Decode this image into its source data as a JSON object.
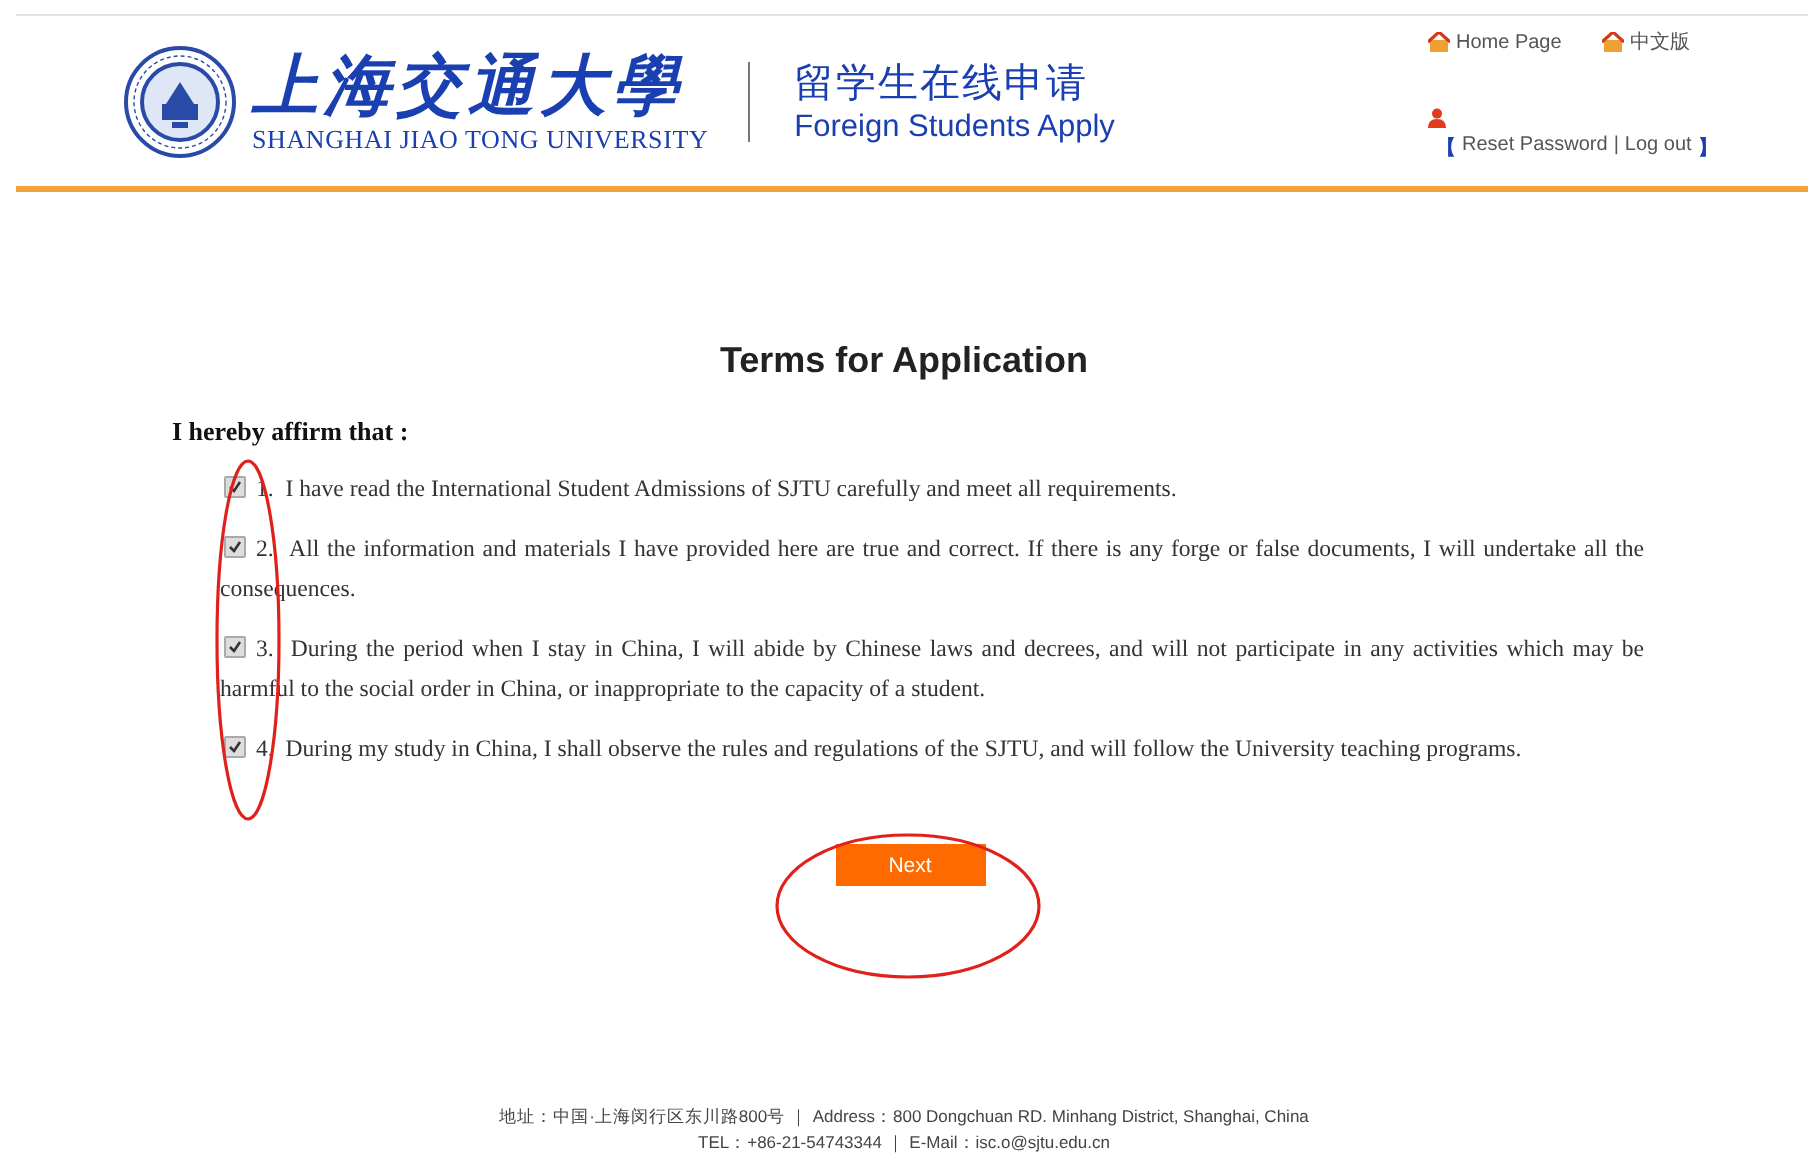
{
  "header": {
    "logo_cn": "上海交通大學",
    "logo_en": "SHANGHAI JIAO TONG UNIVERSITY",
    "app_cn": "留学生在线申请",
    "app_en": "Foreign Students Apply",
    "links": [
      {
        "label": "Home Page"
      },
      {
        "label": "中文版"
      }
    ],
    "account": {
      "open": "【",
      "links": [
        "Reset Password",
        "Log out"
      ],
      "separator": "|",
      "close": "】"
    }
  },
  "title": "Terms for Application",
  "intro": "I hereby affirm that :",
  "terms": [
    {
      "number": "1.",
      "text": "I have read the International Student Admissions of SJTU carefully and meet all requirements.",
      "checked": true
    },
    {
      "number": "2.",
      "text": "All the information and materials I have provided here are true and correct. If there is any forge or false documents, I will undertake all the consequences.",
      "checked": true
    },
    {
      "number": "3.",
      "text": "During the period when I stay in China, I will abide by Chinese laws and decrees, and will not participate in any activities which may be harmful to the social order in China, or inappropriate to the capacity of a student.",
      "checked": true
    },
    {
      "number": "4.",
      "text": "During my study in China, I shall observe the rules and regulations of the SJTU, and will follow the University teaching programs.",
      "checked": true
    }
  ],
  "next_button": "Next",
  "footer": [
    "地址：中国·上海闵行区东川路800号 ｜ Address：800 Dongchuan RD. Minhang District, Shanghai, China",
    "TEL：+86-21-54743344 ｜ E-Mail：isc.o@sjtu.edu.cn"
  ]
}
